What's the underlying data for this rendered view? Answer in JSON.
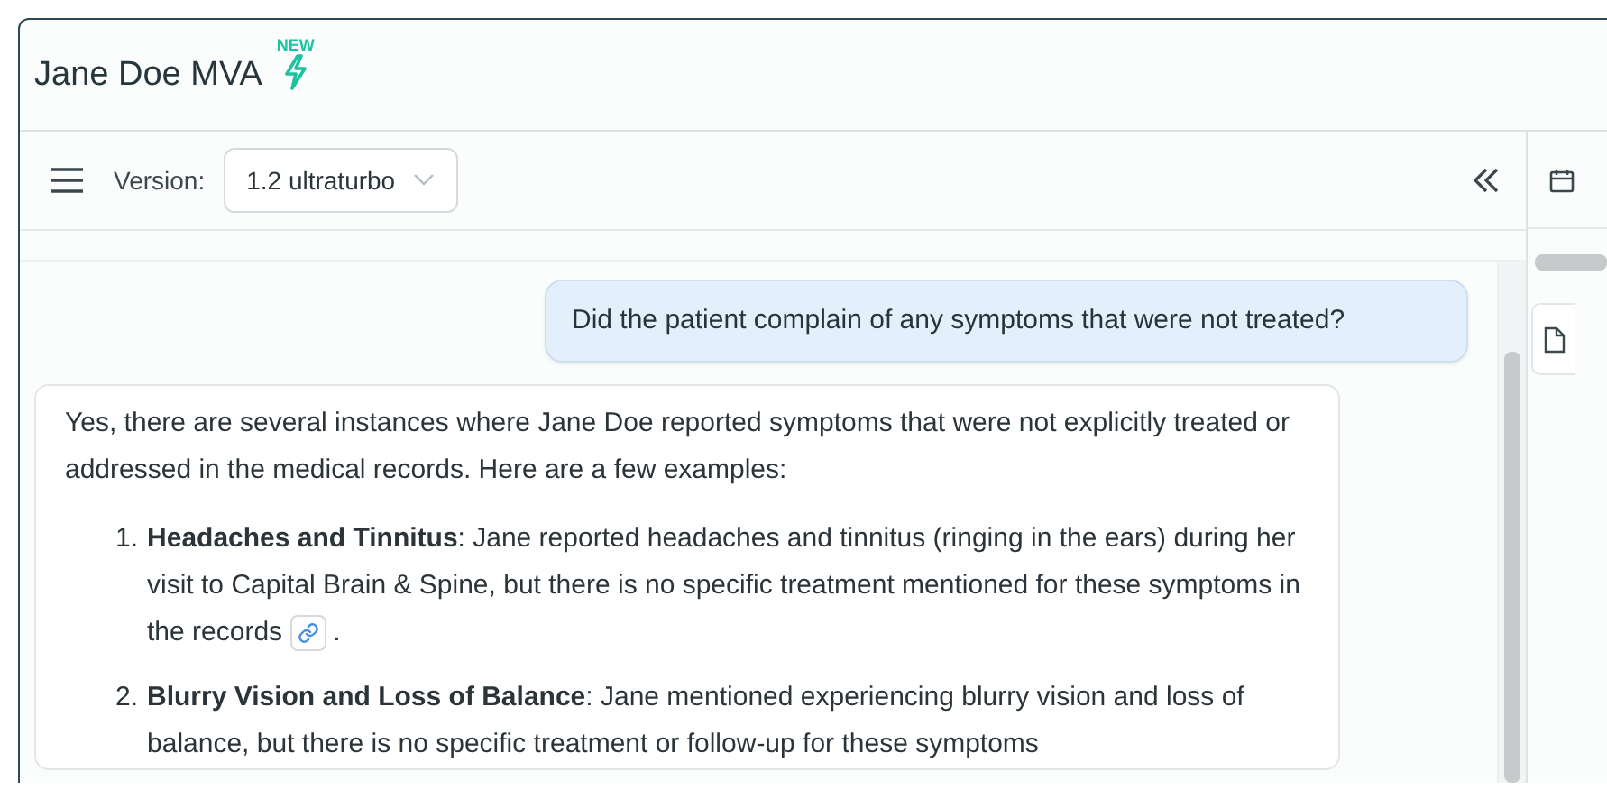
{
  "header": {
    "title": "Jane Doe MVA",
    "badge": "NEW"
  },
  "toolbar": {
    "version_label": "Version:",
    "version_value": "1.2 ultraturbo"
  },
  "messages": [
    {
      "kind": "user",
      "text": "Did the patient complain of any symptoms that were not treated?"
    },
    {
      "kind": "assistant",
      "intro": "Yes, there are several instances where Jane Doe reported symptoms that were not explicitly treated or addressed in the medical records. Here are a few examples:",
      "items": [
        {
          "number": "1.",
          "text": "**Headaches and Tinnitus**: Jane reported headaches and tinnitus (ringing in the ears) during her visit to Capital Brain & Spine, but there is no specific treatment mentioned for these symptoms in the records",
          "citation": true,
          "suffix": "."
        },
        {
          "number": "2.",
          "text": "**Blurry Vision and Loss of Balance**: Jane mentioned experiencing blurry vision and loss of balance, but there is no specific treatment or follow-up for these symptoms"
        }
      ]
    }
  ]
}
